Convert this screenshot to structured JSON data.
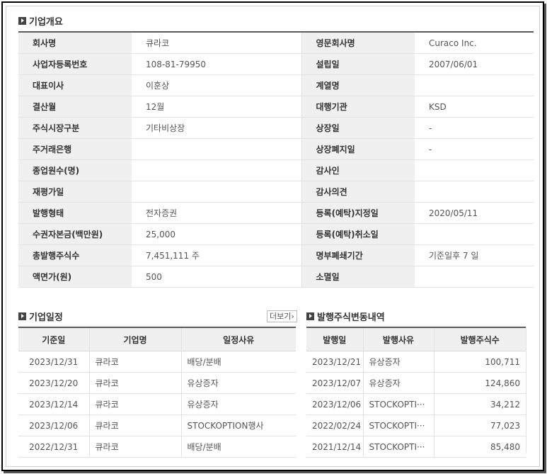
{
  "overview": {
    "title": "기업개요",
    "rows": [
      {
        "l1": "회사명",
        "v1": "큐라코",
        "l2": "영문회사명",
        "v2": "Curaco Inc."
      },
      {
        "l1": "사업자등록번호",
        "v1": "108-81-79950",
        "l2": "설립일",
        "v2": "2007/06/01"
      },
      {
        "l1": "대표이사",
        "v1": "이훈상",
        "l2": "계열명",
        "v2": ""
      },
      {
        "l1": "결산월",
        "v1": "12월",
        "l2": "대행기관",
        "v2": "KSD"
      },
      {
        "l1": "주식시장구분",
        "v1": "기타비상장",
        "l2": "상장일",
        "v2": "-"
      },
      {
        "l1": "주거래은행",
        "v1": "",
        "l2": "상장폐지일",
        "v2": "-"
      },
      {
        "l1": "종업원수(명)",
        "v1": "",
        "l2": "감사인",
        "v2": ""
      },
      {
        "l1": "재평가일",
        "v1": "",
        "l2": "감사의견",
        "v2": ""
      },
      {
        "l1": "발행형태",
        "v1": "전자증권",
        "l2": "등록(예탁)지정일",
        "v2": "2020/05/11"
      },
      {
        "l1": "수권자본금(백만원)",
        "v1": "25,000",
        "l2": "등록(예탁)취소일",
        "v2": ""
      },
      {
        "l1": "총발행주식수",
        "v1": "7,451,111 주",
        "l2": "명부폐쇄기간",
        "v2": "기준일후 7 일"
      },
      {
        "l1": "액면가(원)",
        "v1": "500",
        "l2": "소멸일",
        "v2": ""
      }
    ]
  },
  "schedule": {
    "title": "기업일정",
    "more_label": "더보기",
    "headers": [
      "기준일",
      "기업명",
      "일정사유"
    ],
    "rows": [
      [
        "2023/12/31",
        "큐라코",
        "배당/분배"
      ],
      [
        "2023/12/20",
        "큐라코",
        "유상증자"
      ],
      [
        "2023/12/14",
        "큐라코",
        "유상증자"
      ],
      [
        "2023/12/06",
        "큐라코",
        "STOCKOPTION행사"
      ],
      [
        "2022/12/31",
        "큐라코",
        "배당/분배"
      ]
    ]
  },
  "issue": {
    "title": "발행주식변동내역",
    "headers": [
      "발행일",
      "발행사유",
      "발행주식수"
    ],
    "rows": [
      [
        "2023/12/21",
        "유상증자",
        "100,711"
      ],
      [
        "2023/12/07",
        "유상증자",
        "124,860"
      ],
      [
        "2023/12/06",
        "STOCKOPTI···",
        "34,212"
      ],
      [
        "2022/02/24",
        "STOCKOPTI···",
        "77,023"
      ],
      [
        "2021/12/14",
        "STOCKOPTI···",
        "85,480"
      ]
    ]
  }
}
